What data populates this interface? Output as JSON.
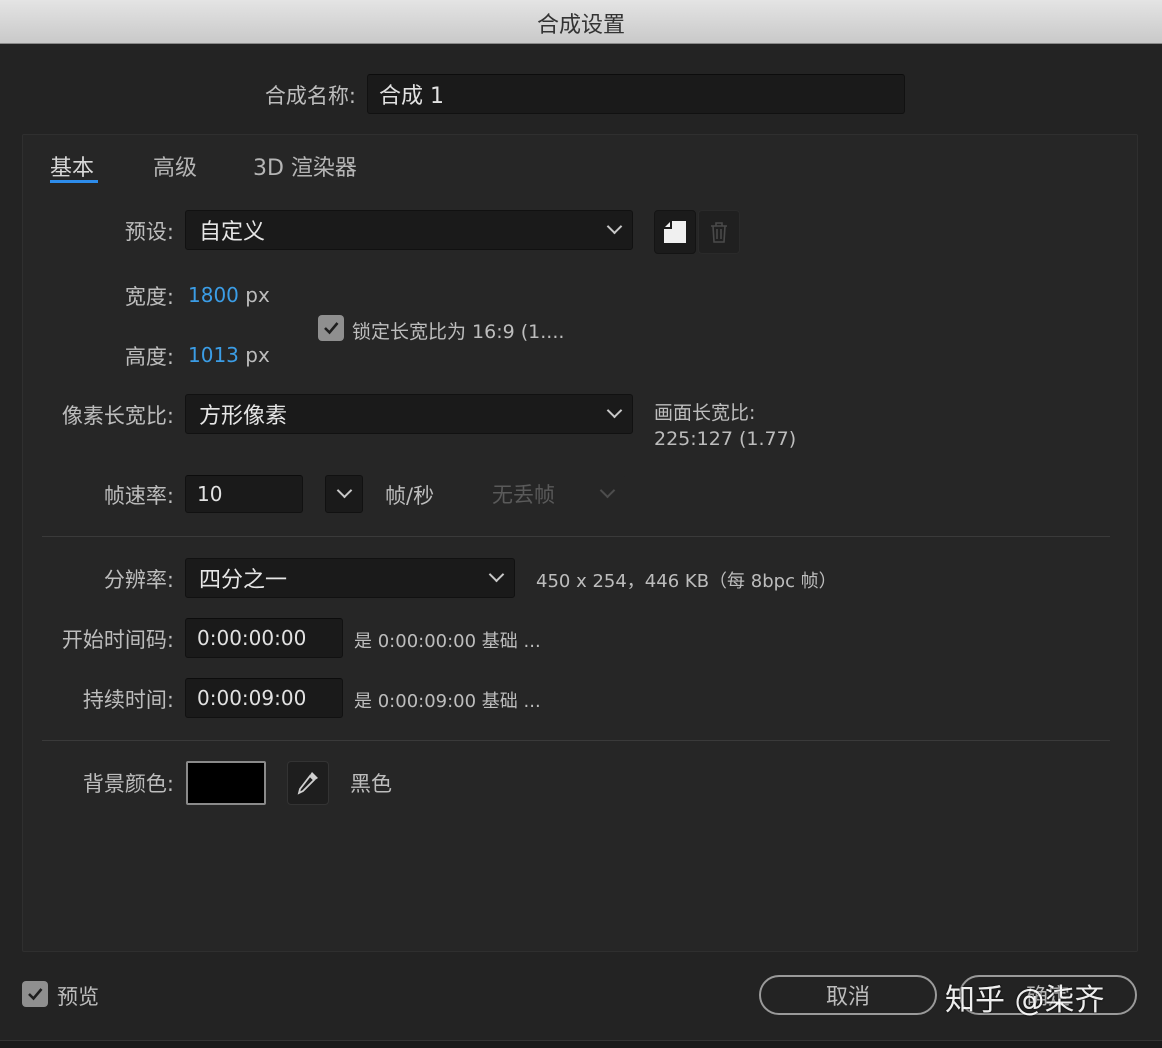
{
  "window": {
    "title": "合成设置"
  },
  "composition": {
    "name_label": "合成名称:",
    "name_value": "合成 1"
  },
  "tabs": [
    {
      "label": "基本",
      "active": true
    },
    {
      "label": "高级",
      "active": false
    },
    {
      "label": "3D 渲染器",
      "active": false
    }
  ],
  "preset": {
    "label": "预设:",
    "value": "自定义"
  },
  "width": {
    "label": "宽度:",
    "value": "1800",
    "unit": "px"
  },
  "height": {
    "label": "高度:",
    "value": "1013",
    "unit": "px"
  },
  "lock_aspect": {
    "label": "锁定长宽比为 16:9 (1....",
    "checked": true
  },
  "pixel_aspect": {
    "label": "像素长宽比:",
    "value": "方形像素"
  },
  "frame_aspect": {
    "label": "画面长宽比:",
    "value": "225:127 (1.77)"
  },
  "frame_rate": {
    "label": "帧速率:",
    "value": "10",
    "unit": "帧/秒",
    "drop_frame": "无丢帧"
  },
  "resolution": {
    "label": "分辨率:",
    "value": "四分之一",
    "info": "450 x 254，446 KB（每 8bpc 帧）"
  },
  "start_timecode": {
    "label": "开始时间码:",
    "value": "0:00:00:00",
    "info": "是 0:00:00:00  基础 ..."
  },
  "duration": {
    "label": "持续时间:",
    "value": "0:00:09:00",
    "info": "是 0:00:09:00  基础 ..."
  },
  "background": {
    "label": "背景颜色:",
    "color": "#000000",
    "color_name": "黑色"
  },
  "footer": {
    "preview_label": "预览",
    "preview_checked": true,
    "cancel_label": "取消",
    "ok_label": "确定"
  },
  "watermark": {
    "text": "知乎 @柒齐"
  },
  "colors": {
    "accent": "#2d8ceb",
    "value_blue": "#3b9de6",
    "background": "#232323"
  }
}
